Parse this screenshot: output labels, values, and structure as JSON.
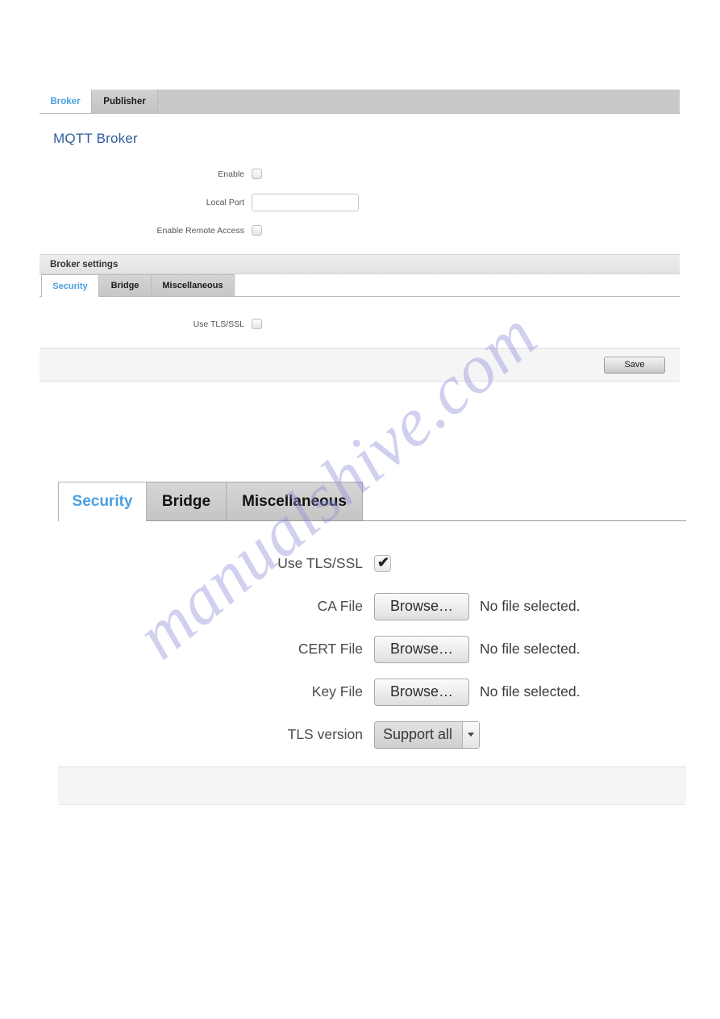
{
  "upper": {
    "tabs": [
      {
        "label": "Broker",
        "active": true
      },
      {
        "label": "Publisher",
        "active": false
      }
    ],
    "page_title": "MQTT Broker",
    "fields": [
      {
        "label": "Enable",
        "type": "checkbox",
        "checked": false
      },
      {
        "label": "Local Port",
        "type": "text",
        "value": "",
        "placeholder": ""
      },
      {
        "label": "Enable Remote Access",
        "type": "checkbox",
        "checked": false
      }
    ],
    "section_header": "Broker settings",
    "subtabs": [
      {
        "label": "Security",
        "active": true
      },
      {
        "label": "Bridge",
        "active": false
      },
      {
        "label": "Miscellaneous",
        "active": false
      }
    ],
    "sub_fields": [
      {
        "label": "Use TLS/SSL",
        "type": "checkbox",
        "checked": false
      }
    ],
    "save_label": "Save"
  },
  "lower": {
    "subtabs": [
      {
        "label": "Security",
        "active": true
      },
      {
        "label": "Bridge",
        "active": false
      },
      {
        "label": "Miscellaneous",
        "active": false
      }
    ],
    "rows": [
      {
        "label": "Use TLS/SSL",
        "type": "checkbox",
        "checked": true,
        "tick": "✔"
      },
      {
        "label": "CA File",
        "type": "file",
        "button": "Browse…",
        "status": "No file selected."
      },
      {
        "label": "CERT File",
        "type": "file",
        "button": "Browse…",
        "status": "No file selected."
      },
      {
        "label": "Key File",
        "type": "file",
        "button": "Browse…",
        "status": "No file selected."
      },
      {
        "label": "TLS version",
        "type": "select",
        "value": "Support all",
        "arrow": "chevron-down-icon"
      }
    ]
  },
  "watermark": {
    "text": "manualshive.com"
  },
  "colors": {
    "accent_tab": "#4a9fe0",
    "heading": "#2f5c9e",
    "tabbar_bg": "#c9c9c9",
    "panel_bg": "#ffffff",
    "footer_bg": "#f5f5f5",
    "watermark": "#8c8cd8"
  }
}
